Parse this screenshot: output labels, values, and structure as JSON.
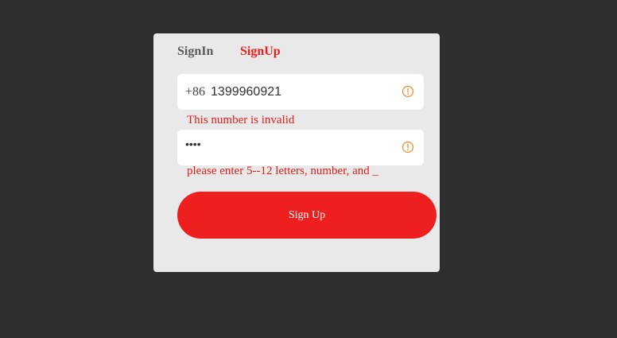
{
  "tabs": {
    "signin_label": "SignIn",
    "signup_label": "SignUp",
    "active": "SignUp"
  },
  "phone": {
    "country_code": "+86",
    "value": "1399960921",
    "error": "This number is invalid"
  },
  "password": {
    "value": "••••",
    "error": "please enter 5--12 letters, number, and _"
  },
  "submit": {
    "label": "Sign Up"
  },
  "icons": {
    "phone_status": "warning-circle-icon",
    "password_status": "warning-circle-icon"
  },
  "colors": {
    "accent": "#ee1f1f",
    "error_text": "#e31c1c",
    "warning_icon": "#f08a2e",
    "card_background": "#e9e9e9",
    "page_background": "#2e2e2e"
  }
}
